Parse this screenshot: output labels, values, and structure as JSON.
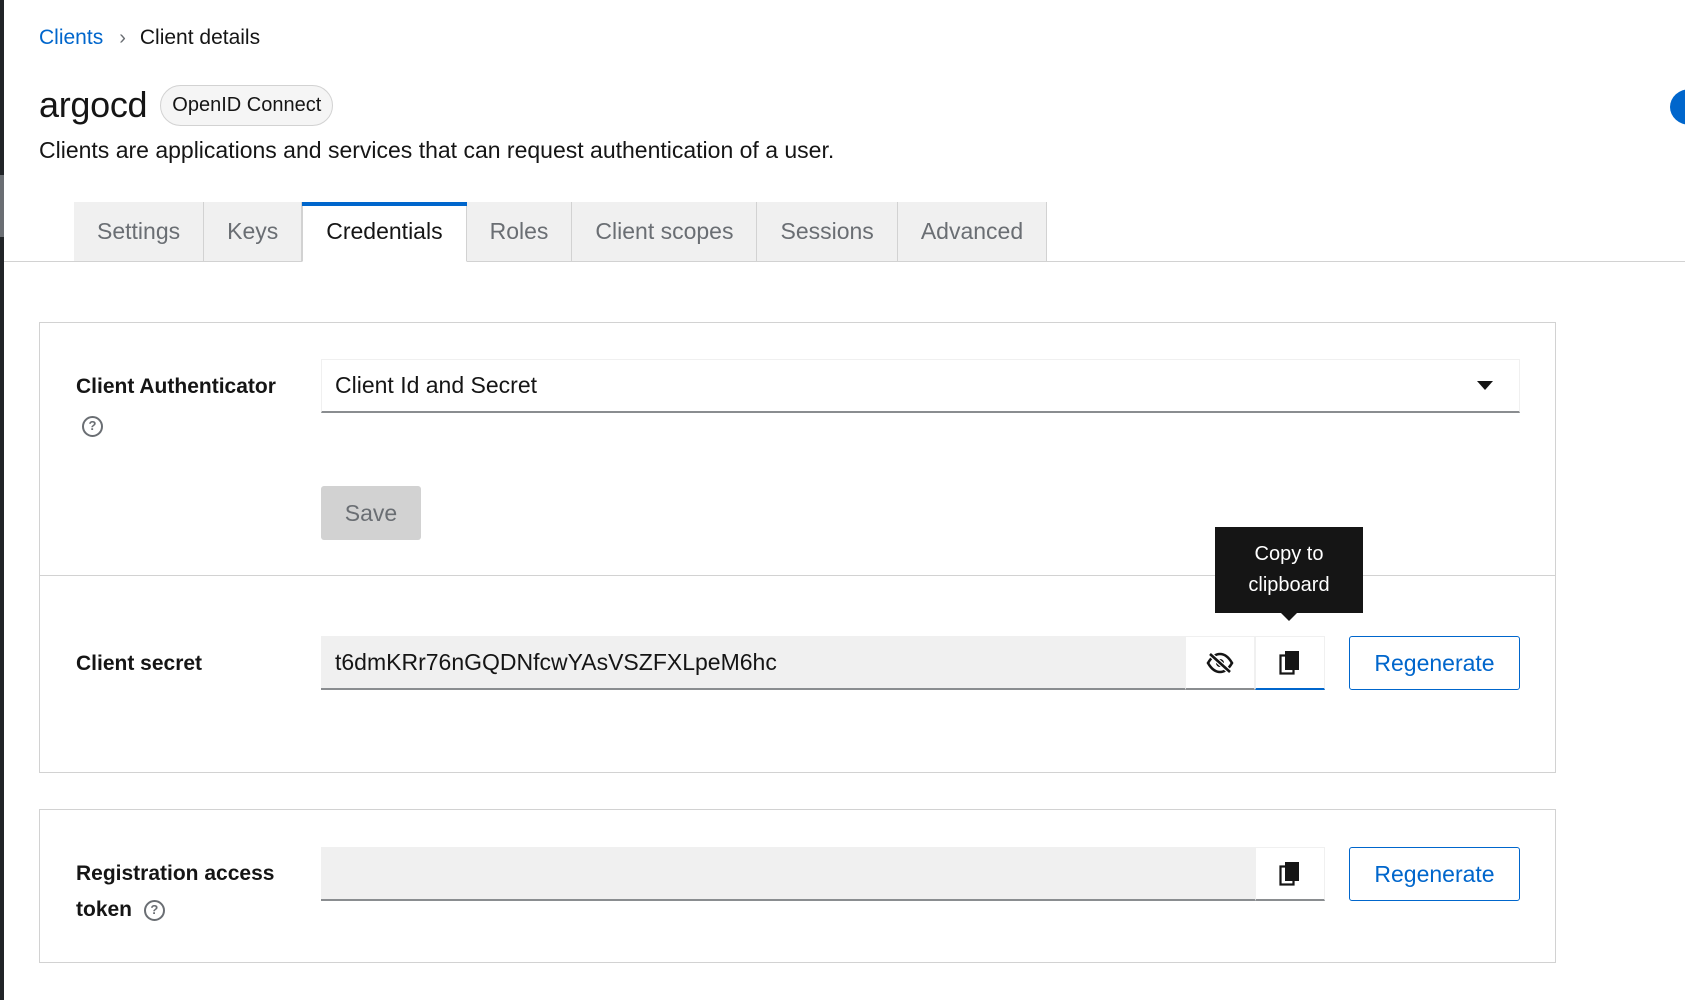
{
  "breadcrumb": {
    "parent": "Clients",
    "separator": "›",
    "current": "Client details"
  },
  "header": {
    "title": "argocd",
    "badge": "OpenID Connect",
    "description": "Clients are applications and services that can request authentication of a user."
  },
  "tabs": [
    {
      "label": "Settings",
      "active": false
    },
    {
      "label": "Keys",
      "active": false
    },
    {
      "label": "Credentials",
      "active": true
    },
    {
      "label": "Roles",
      "active": false
    },
    {
      "label": "Client scopes",
      "active": false
    },
    {
      "label": "Sessions",
      "active": false
    },
    {
      "label": "Advanced",
      "active": false
    }
  ],
  "authenticator": {
    "label": "Client Authenticator",
    "help_icon": "question-circle-icon",
    "selected": "Client Id and Secret",
    "save_label": "Save"
  },
  "secret": {
    "label": "Client secret",
    "value": "t6dmKRr76nGQDNfcwYAsVSZFXLpeM6hc",
    "visibility_icon": "eye-slash-icon",
    "copy_icon": "copy-icon",
    "regenerate_label": "Regenerate",
    "tooltip": "Copy to clipboard"
  },
  "registration": {
    "label_line1": "Registration access",
    "label_line2": "token",
    "help_icon": "question-circle-icon",
    "value": "",
    "copy_icon": "copy-icon",
    "regenerate_label": "Regenerate"
  },
  "colors": {
    "accent": "#0066cc",
    "tooltip_bg": "#151515",
    "disabled_bg": "#d2d2d2"
  }
}
